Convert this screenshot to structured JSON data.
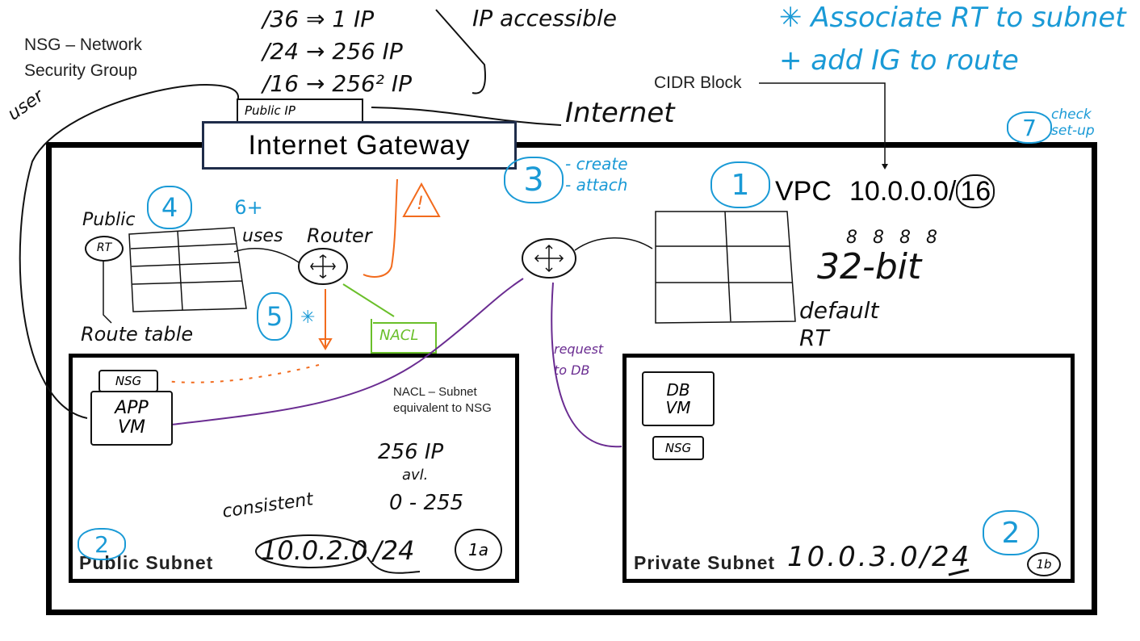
{
  "notes": {
    "nsg_def_line1": "NSG – Network",
    "nsg_def_line2": "Security Group",
    "cidr_line1": "/36 ⇒ 1 IP",
    "cidr_line2": "/24 → 256 IP",
    "cidr_line3": "/16 → 256² IP",
    "ip_accessible": "IP accessible",
    "associate": "✳ Associate RT to subnet",
    "add_ig": "+ add IG to route",
    "cidr_block": "CIDR Block",
    "internet": "Internet",
    "user": "user",
    "public_ip": "Public IP",
    "check_setup": "check set-up",
    "create": "- create",
    "attach": "- attach",
    "public_rt": "Public",
    "rt": "RT",
    "route_table": "Route table",
    "uses": "uses",
    "router": "Router",
    "nacl": "NACL",
    "nacl_def_line1": "NACL – Subnet",
    "nacl_def_line2": "equivalent to NSG",
    "request_to_db": "request to DB",
    "default_rt_line1": "default",
    "default_rt_line2": "RT",
    "bits": "8 8 8 8",
    "bit32": "32-bit",
    "ips_256": "256 IP",
    "avl": "avl.",
    "range": "0 - 255",
    "consistent": "consistent",
    "warning": "!"
  },
  "gateway": {
    "label": "Internet Gateway"
  },
  "vpc": {
    "label": "VPC",
    "cidr": "10.0.0.0/",
    "mask": "16"
  },
  "public_subnet": {
    "label": "Public Subnet",
    "cidr": "10.0.2.0",
    "mask": "/24",
    "az": "1a"
  },
  "private_subnet": {
    "label": "Private Subnet",
    "cidr": "10.0.3.0/24",
    "az": "1b"
  },
  "app_vm": {
    "nsg": "NSG",
    "label_line1": "APP",
    "label_line2": "VM"
  },
  "db_vm": {
    "nsg": "NSG",
    "label_line1": "DB",
    "label_line2": "VM"
  },
  "steps": {
    "s1": "1",
    "s2a": "2",
    "s2b": "2",
    "s3": "3",
    "s4": "4",
    "s5": "5",
    "s6": "6+",
    "s7": "7",
    "star": "✳"
  },
  "colors": {
    "blue": "#1a9ad6",
    "orange": "#f26b1d",
    "green": "#6abf2a",
    "purple": "#6a2c91",
    "gateway_border": "#1f2d4a"
  }
}
